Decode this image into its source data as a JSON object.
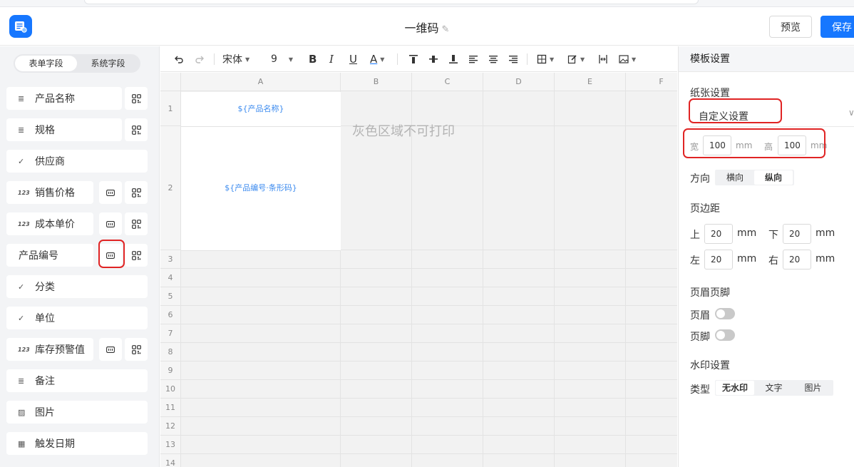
{
  "header": {
    "title": "一维码",
    "preview_label": "预览",
    "save_label": "保存"
  },
  "left_panel": {
    "tabs": [
      {
        "label": "表单字段",
        "active": true
      },
      {
        "label": "系统字段",
        "active": false
      }
    ],
    "fields": [
      {
        "label": "产品名称",
        "icon": "text-lines-icon",
        "icon_glyph": "≣",
        "barcode": false,
        "qrcode": true
      },
      {
        "label": "规格",
        "icon": "text-lines-icon",
        "icon_glyph": "≣",
        "barcode": false,
        "qrcode": true
      },
      {
        "label": "供应商",
        "icon": "check-icon",
        "icon_glyph": "✓",
        "barcode": false,
        "qrcode": false
      },
      {
        "label": "销售价格",
        "icon": "number-icon",
        "icon_glyph": "123",
        "barcode": true,
        "qrcode": true
      },
      {
        "label": "成本单价",
        "icon": "number-icon",
        "icon_glyph": "123",
        "barcode": true,
        "qrcode": true
      },
      {
        "label": "产品编号",
        "icon": "",
        "icon_glyph": "",
        "barcode": true,
        "qrcode": true
      },
      {
        "label": "分类",
        "icon": "check-icon",
        "icon_glyph": "✓",
        "barcode": false,
        "qrcode": false
      },
      {
        "label": "单位",
        "icon": "check-icon",
        "icon_glyph": "✓",
        "barcode": false,
        "qrcode": false
      },
      {
        "label": "库存预警值",
        "icon": "number-icon",
        "icon_glyph": "123",
        "barcode": true,
        "qrcode": true
      },
      {
        "label": "备注",
        "icon": "text-lines-icon",
        "icon_glyph": "≣",
        "barcode": false,
        "qrcode": false
      },
      {
        "label": "图片",
        "icon": "image-icon",
        "icon_glyph": "▨",
        "barcode": false,
        "qrcode": false
      },
      {
        "label": "触发日期",
        "icon": "calendar-icon",
        "icon_glyph": "▦",
        "barcode": false,
        "qrcode": false
      }
    ]
  },
  "toolbar": {
    "font": "宋体",
    "font_size": "9",
    "bold": "B",
    "italic": "I",
    "underline": "U",
    "font_color": "A"
  },
  "sheet": {
    "columns": [
      "A",
      "B",
      "C",
      "D",
      "E",
      "F"
    ],
    "rows": [
      "1",
      "2",
      "3",
      "4",
      "5",
      "6",
      "7",
      "8",
      "9",
      "10",
      "11",
      "12",
      "13",
      "14"
    ],
    "cell_a1": "${产品名称}",
    "cell_a2": "${产品编号·条形码}",
    "gray_hint": "灰色区域不可打印"
  },
  "settings": {
    "title": "模板设置",
    "paper_label": "纸张设置",
    "paper_value": "自定义设置",
    "width_label": "宽",
    "width_value": "100",
    "height_label": "高",
    "height_value": "100",
    "unit": "mm",
    "orientation_label": "方向",
    "orientation_options": [
      {
        "label": "横向",
        "active": false
      },
      {
        "label": "纵向",
        "active": true
      }
    ],
    "margin_label": "页边距",
    "margin_top_label": "上",
    "margin_top": "20",
    "margin_bottom_label": "下",
    "margin_bottom": "20",
    "margin_left_label": "左",
    "margin_left": "20",
    "margin_right_label": "右",
    "margin_right": "20",
    "header_footer_label": "页眉页脚",
    "header_toggle_label": "页眉",
    "footer_toggle_label": "页脚",
    "watermark_label": "水印设置",
    "watermark_type_label": "类型",
    "watermark_options": [
      {
        "label": "无水印",
        "active": true
      },
      {
        "label": "文字",
        "active": false
      },
      {
        "label": "图片",
        "active": false
      }
    ]
  },
  "colors": {
    "accent": "#1677ff",
    "highlight_red": "#e02424",
    "placeholder_blue": "#3c8bef"
  }
}
